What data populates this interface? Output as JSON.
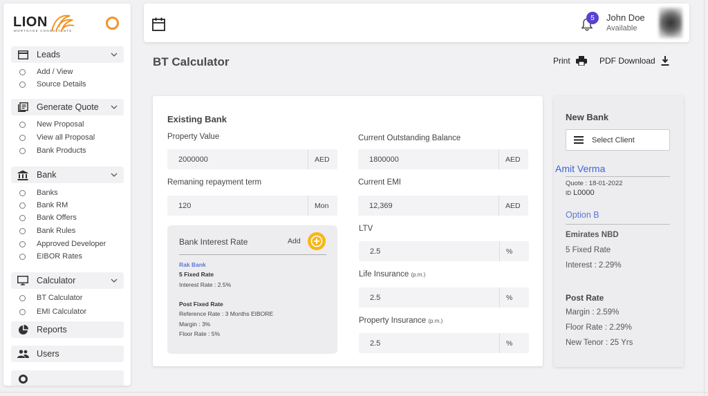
{
  "brand": {
    "name": "LION",
    "subtitle": "MORTGAGE CONSULTANTS"
  },
  "sidebar": {
    "sections": [
      {
        "label": "Leads",
        "items": [
          "Add / View",
          "Source Details"
        ]
      },
      {
        "label": "Generate Quote",
        "items": [
          "New Proposal",
          "View all Proposal",
          "Bank Products"
        ]
      },
      {
        "label": "Bank",
        "items": [
          "Banks",
          "Bank RM",
          "Bank Offers",
          "Bank Rules",
          "Approved Developer",
          "EIBOR Rates"
        ]
      },
      {
        "label": "Calculator",
        "items": [
          "BT Calculator",
          "EMI Calculator"
        ]
      }
    ],
    "links": [
      {
        "label": "Reports"
      },
      {
        "label": "Users"
      }
    ]
  },
  "topbar": {
    "notifications": "5",
    "user_name": "John Doe",
    "user_status": "Available"
  },
  "page": {
    "title": "BT Calculator",
    "print_label": "Print",
    "pdf_label": "PDF Download"
  },
  "existing_bank": {
    "title": "Existing Bank",
    "property_value": {
      "label": "Property Value",
      "value": "2000000",
      "unit": "AED"
    },
    "repayment_term": {
      "label": "Remaning repayment term",
      "value": "120",
      "unit": "Mon"
    },
    "outstanding_balance": {
      "label": "Current Outstanding Balance",
      "value": "1800000",
      "unit": "AED"
    },
    "current_emi": {
      "label": "Current EMI",
      "value": "12,369",
      "unit": "AED"
    },
    "ltv": {
      "label": "LTV",
      "value": "2.5",
      "unit": "%"
    },
    "life_insurance": {
      "label": "Life Insurance",
      "suffix": "(p.m.)",
      "value": "2.5",
      "unit": "%"
    },
    "property_insurance": {
      "label": "Property Insurance",
      "suffix": "(p.m.)",
      "value": "2.5",
      "unit": "%"
    },
    "interest": {
      "title": "Bank Interest Rate",
      "add_label": "Add",
      "bank": "Rak Bank",
      "fixed": "5 Fixed Rate",
      "interest_rate": "Interest Rate : 2.5%",
      "post_title": "Post Fixed Rate",
      "reference": "Reference Rate : 3 Months EIBORE",
      "margin": "Margin : 3%",
      "floor": "Floor Rate : 5%"
    }
  },
  "new_bank": {
    "title": "New Bank",
    "select_label": "Select Client",
    "client_name": "Amit Verma",
    "quote": "Quote : 18-01-2022",
    "id_label": "ID",
    "id_value": "L0000",
    "option": "Option B",
    "bank": "Emirates NBD",
    "fixed": "5 Fixed Rate",
    "interest": "Interest : 2.29%",
    "post_title": "Post Rate",
    "margin": "Margin : 2.59%",
    "floor": "Floor Rate : 2.29%",
    "tenor": "New Tenor : 25 Yrs"
  },
  "colors": {
    "accent": "#f29322",
    "badge": "#5b3fd6",
    "link": "#3b63d6",
    "add": "#f7b718"
  }
}
